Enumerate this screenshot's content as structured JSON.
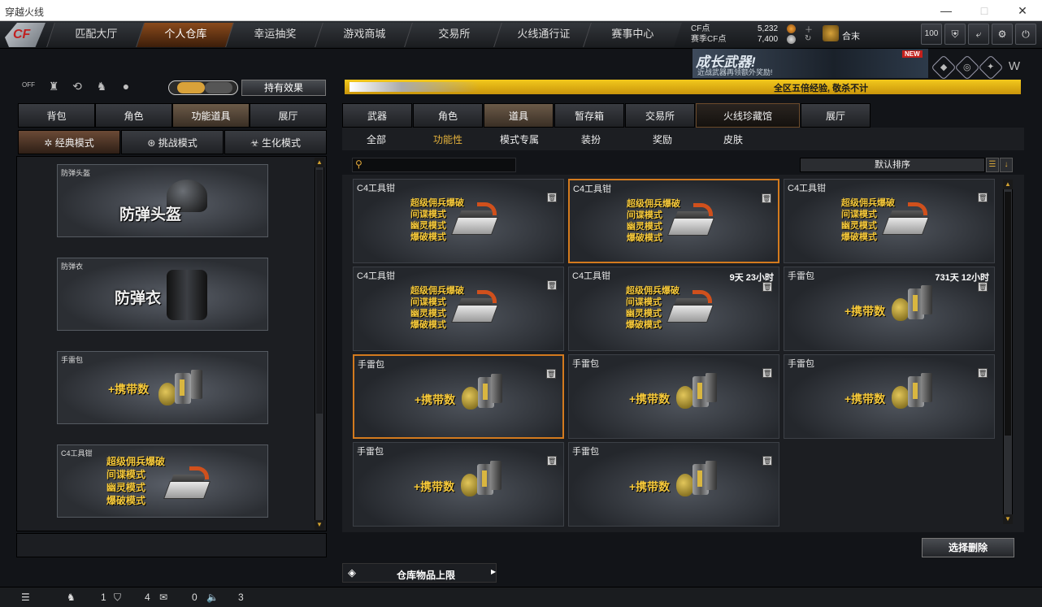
{
  "window": {
    "title": "穿越火线",
    "minimize": "—",
    "maximize": "□",
    "close": "✕"
  },
  "logo": "CF",
  "nav": [
    "匹配大厅",
    "个人仓库",
    "幸运抽奖",
    "游戏商城",
    "交易所",
    "火线通行证",
    "赛事中心"
  ],
  "nav_active": 1,
  "currency": {
    "cf_label": "CF点",
    "cf_value": "5,232",
    "match_label": "赛季CF点",
    "match_value": "7,400"
  },
  "user": {
    "name": "合末"
  },
  "top_buttons": [
    "100",
    "⛨",
    "⤶",
    "⚙",
    "⏻"
  ],
  "banner": {
    "title": "成长武器!",
    "subtitle": "近战武器再领额外奖励!",
    "badge": "NEW"
  },
  "left_toolbar": {
    "off_label": "OFF",
    "effect_button": "持有效果"
  },
  "gold_banner": {
    "message": "全区五倍经验, 敬杀不计"
  },
  "left_tabs": [
    "背包",
    "角色",
    "功能道具",
    "展厅"
  ],
  "left_tab_active": 2,
  "mode_tabs": [
    "经典模式",
    "挑战模式",
    "生化模式"
  ],
  "mode_tab_active": 0,
  "left_items": [
    {
      "name": "防弹头盔",
      "label": "防弹头盔"
    },
    {
      "name": "防弹衣",
      "label": "防弹衣"
    },
    {
      "name": "手雷包",
      "label": "+携带数"
    },
    {
      "name": "C4工具钳",
      "modes": [
        "超级佣兵爆破",
        "间谍模式",
        "幽灵模式",
        "爆破模式"
      ]
    }
  ],
  "right_tabs": [
    "武器",
    "角色",
    "道具",
    "暂存箱",
    "交易所",
    "火线珍藏馆",
    "展厅"
  ],
  "right_tab_active": 2,
  "categories": [
    "全部",
    "功能性",
    "模式专属",
    "装扮",
    "奖励",
    "皮肤"
  ],
  "category_active": 1,
  "sort": {
    "label": "默认排序"
  },
  "items": [
    {
      "name": "C4工具钳",
      "type": "c4",
      "time": ""
    },
    {
      "name": "C4工具钳",
      "type": "c4",
      "time": ""
    },
    {
      "name": "C4工具钳",
      "type": "c4",
      "time": ""
    },
    {
      "name": "C4工具钳",
      "type": "c4",
      "time": ""
    },
    {
      "name": "C4工具钳",
      "type": "c4",
      "time": "9天 23小时"
    },
    {
      "name": "手雷包",
      "type": "nade",
      "time": "731天 12小时"
    },
    {
      "name": "手雷包",
      "type": "nade",
      "time": ""
    },
    {
      "name": "手雷包",
      "type": "nade",
      "time": ""
    },
    {
      "name": "手雷包",
      "type": "nade",
      "time": ""
    },
    {
      "name": "手雷包",
      "type": "nade",
      "time": ""
    },
    {
      "name": "手雷包",
      "type": "nade",
      "time": ""
    }
  ],
  "c4_modes": [
    "超级佣兵爆破",
    "间谍模式",
    "幽灵模式",
    "爆破模式"
  ],
  "carry_label": "+携带数",
  "delete_button": "选择删除",
  "storage_label": "仓库物品上限",
  "status": {
    "friends": "1",
    "clan": "4",
    "chat": "0",
    "sound": "3"
  }
}
